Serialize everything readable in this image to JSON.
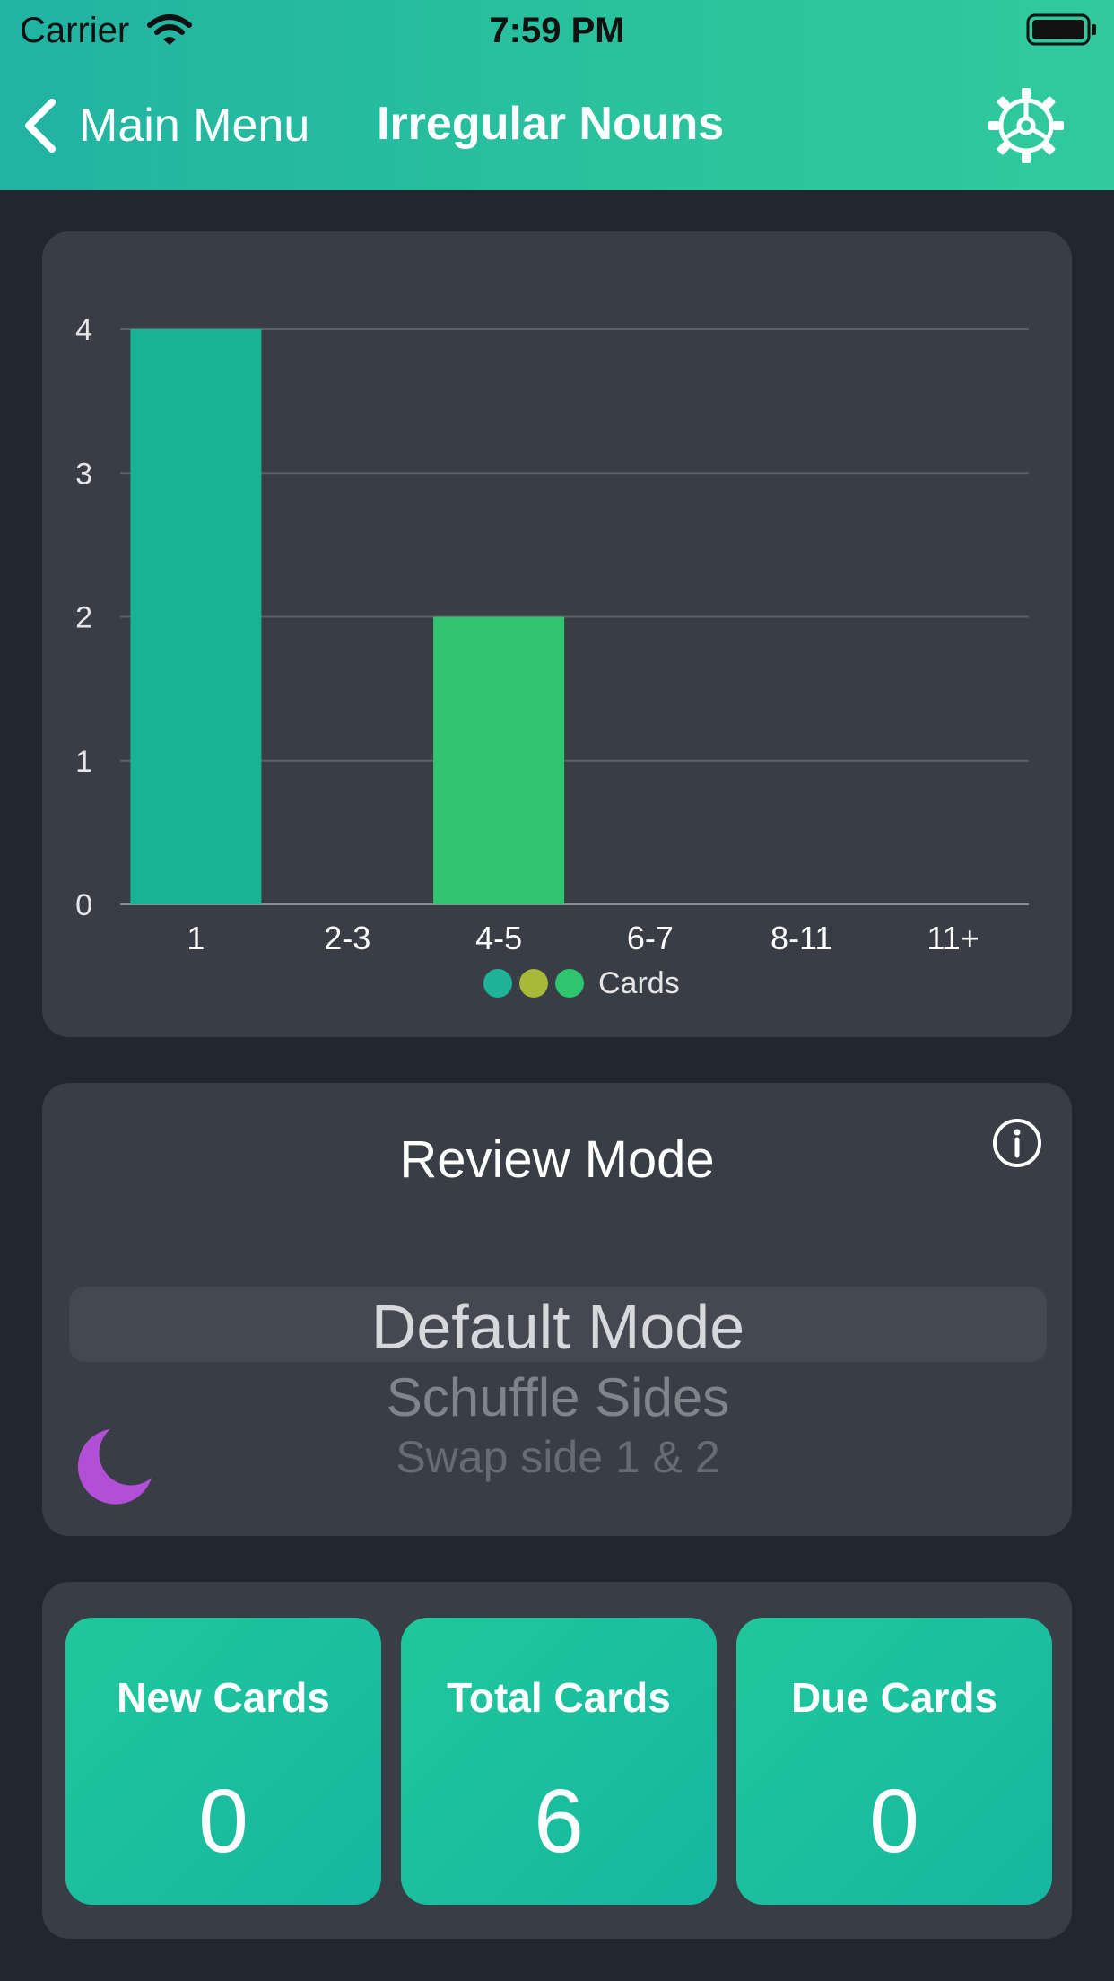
{
  "status_bar": {
    "carrier": "Carrier",
    "time": "7:59 PM"
  },
  "nav": {
    "back_label": "Main Menu",
    "title": "Irregular Nouns"
  },
  "chart_data": {
    "type": "bar",
    "categories": [
      "1",
      "2-3",
      "4-5",
      "6-7",
      "8-11",
      "11+"
    ],
    "values": [
      4,
      0,
      2,
      0,
      0,
      0
    ],
    "bar_colors": [
      "#17b394",
      "#17b394",
      "#32c46e",
      "#32c46e",
      "#32c46e",
      "#32c46e"
    ],
    "yticks": [
      0,
      1,
      2,
      3,
      4
    ],
    "ylim": [
      0,
      4
    ],
    "grid": true,
    "legend": {
      "label": "Cards",
      "dot_colors": [
        "#1fb39a",
        "#a6b938",
        "#2fc46e"
      ],
      "position": "bottom-center"
    }
  },
  "review_mode": {
    "title": "Review Mode",
    "options": [
      "Default Mode",
      "Schuffle Sides",
      "Swap side 1 & 2"
    ],
    "selected": "Default Mode"
  },
  "stats": [
    {
      "label": "New Cards",
      "value": "0"
    },
    {
      "label": "Total Cards",
      "value": "6"
    },
    {
      "label": "Due Cards",
      "value": "0"
    }
  ],
  "colors": {
    "header_gradient_start": "#22b3a2",
    "header_gradient_end": "#31c99d",
    "background": "#22272f",
    "card": "#393d46",
    "moon": "#b14fd6"
  }
}
